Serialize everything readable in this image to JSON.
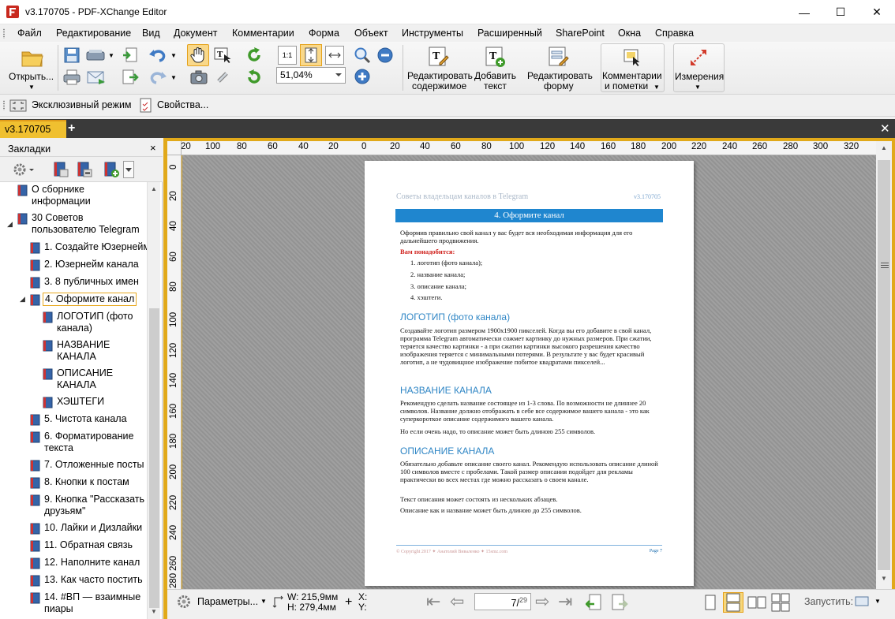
{
  "window": {
    "title": "v3.170705 - PDF-XChange Editor",
    "min": "—",
    "max": "☐",
    "close": "✕"
  },
  "menu": [
    "Файл",
    "Редактирование",
    "Вид",
    "Документ",
    "Комментарии",
    "Форма",
    "Объект",
    "Инструменты",
    "Расширенный",
    "SharePoint",
    "Окна",
    "Справка"
  ],
  "toolbar": {
    "open_label": "Открыть...",
    "zoom_value": "51,04%",
    "edit_content_label_1": "Редактировать",
    "edit_content_label_2": "содержимое",
    "add_text_label_1": "Добавить",
    "add_text_label_2": "текст",
    "edit_form_label_1": "Редактировать",
    "edit_form_label_2": "форму",
    "comments_label_1": "Комментарии",
    "comments_label_2": "и пометки",
    "measure_label": "Измерения"
  },
  "toolbar2": {
    "exclusive_mode": "Эксклюзивный режим",
    "properties": "Свойства..."
  },
  "tabs": {
    "active": "v3.170705",
    "plus": "+",
    "close": "✕"
  },
  "bookmarks": {
    "title": "Закладки",
    "close": "×",
    "items": [
      {
        "line1": "О сборнике",
        "line2": "информации"
      },
      {
        "line1": "30 Советов",
        "line2": "пользователю Telegram"
      },
      {
        "line1": "1. Создайте Юзернейм",
        "line2": ""
      },
      {
        "line1": "2. Юзернейм канала",
        "line2": ""
      },
      {
        "line1": "3. 8 публичных имен",
        "line2": ""
      },
      {
        "line1": "4. Оформите канал",
        "line2": ""
      },
      {
        "line1": "ЛОГОТИП (фото",
        "line2": "канала)"
      },
      {
        "line1": "НАЗВАНИЕ",
        "line2": "КАНАЛА"
      },
      {
        "line1": "ОПИСАНИЕ",
        "line2": "КАНАЛА"
      },
      {
        "line1": "ХЭШТЕГИ",
        "line2": ""
      },
      {
        "line1": "5. Чистота канала",
        "line2": ""
      },
      {
        "line1": "6. Форматирование",
        "line2": "текста"
      },
      {
        "line1": "7. Отложенные посты",
        "line2": ""
      },
      {
        "line1": "8. Кнопки к постам",
        "line2": ""
      },
      {
        "line1": "9. Кнопка \"Рассказать",
        "line2": "друзьям\""
      },
      {
        "line1": "10. Лайки и Дизлайки",
        "line2": ""
      },
      {
        "line1": "11. Обратная связь",
        "line2": ""
      },
      {
        "line1": "12. Наполните канал",
        "line2": ""
      },
      {
        "line1": "13. Как часто постить",
        "line2": ""
      },
      {
        "line1": "14. #ВП — взаимные",
        "line2": "пиары"
      }
    ]
  },
  "ruler": {
    "top": [
      "20",
      "100",
      "80",
      "60",
      "40",
      "20",
      "0",
      "20",
      "40",
      "60",
      "80",
      "100",
      "120",
      "140",
      "160",
      "180",
      "200",
      "220",
      "240",
      "260",
      "280",
      "300",
      "320"
    ],
    "left": [
      "0",
      "20",
      "40",
      "60",
      "80",
      "100",
      "120",
      "140",
      "160",
      "180",
      "200",
      "220",
      "240",
      "260",
      "280"
    ]
  },
  "page": {
    "header_left": "Советы владельцам каналов в Telegram",
    "header_right": "v3.170705",
    "section_title": "4. Оформите канал",
    "intro": "Оформив правильно свой канал у вас будет вся необходимая информация для его дальнейшего продвижения.",
    "need_label": "Вам понадобится:",
    "list": [
      "1.  логотип (фото канала);",
      "2.  название канала;",
      "3.  описание канала;",
      "4.  хэштеги."
    ],
    "h_logo": "ЛОГОТИП (фото канала)",
    "p_logo": "Создавайте логотип размером 1900x1900 пикселей. Когда вы его добавите в свой канал, программа Telegram  автоматически сожмет картинку до нужных размеров. При сжатии, теряется качество картинки - а при сжатии картинки высокого разрешения качество изображения теряется с минимальными потерями. В результате у вас будет красивый логотип, а не чудовищное изображение побитое квадратами пикселей...",
    "h_name": "НАЗВАНИЕ КАНАЛА",
    "p_name": "Рекомендую сделать название состоящее из 1-3 слова. По возможности не длиннее 20 символов. Название должно отображать в себе все содержимое вашего канала - это как суперкороткое описание содержимого вашего канала.",
    "p_name2": "Но если очень надо, то описание может быть длиною 255 символов.",
    "h_desc": "ОПИСАНИЕ КАНАЛА",
    "p_desc": "Обязательно добавьте описание своего канал. Рекомендую использовать описание длиной 100 символов вместе с пробелами. Такой размер описания подойдет для рекламы практически во всех местах где можно рассказать о своем канале.",
    "p_desc2": "Текст описания может состоять из нескольких абзацев.",
    "p_desc3": "Описание как и название может быть длиною до 255 символов.",
    "footer_left": "© Copyright 2017 ✦ Анатолий Виваленко ✦ 15smz.com",
    "footer_right": "Page 7"
  },
  "status": {
    "params": "Параметры...",
    "w_label": "W: 215,9мм",
    "h_label": "H: 279,4мм",
    "x_label": "X:",
    "y_label": "Y:",
    "page_current": "7",
    "page_total": "29",
    "run_label": "Запустить:"
  },
  "colors": {
    "accent_tab": "#f0c030",
    "doc_frame": "#e1a91a",
    "page_bar": "#1f86cf",
    "heading_blue": "#2f86c5",
    "need_red": "#d0231e"
  }
}
